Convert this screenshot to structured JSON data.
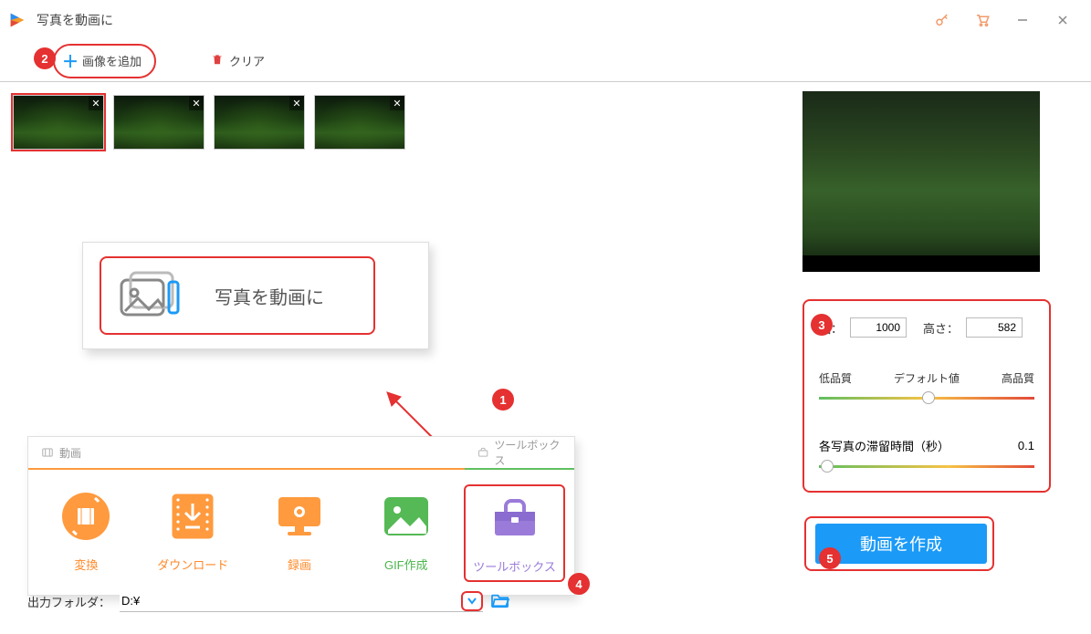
{
  "window": {
    "title": "写真を動画に"
  },
  "toolbar": {
    "add_image_label": "画像を追加",
    "clear_label": "クリア"
  },
  "thumbnails": [
    {
      "close": "✕"
    },
    {
      "close": "✕"
    },
    {
      "close": "✕"
    },
    {
      "close": "✕"
    }
  ],
  "popup": {
    "label": "写真を動画に"
  },
  "tools_tabs": {
    "video_tab": "動画",
    "toolbox_tab": "ツールボックス"
  },
  "tools": {
    "convert": "変換",
    "download": "ダウンロード",
    "record": "録画",
    "gif": "GIF作成",
    "toolbox": "ツールボックス"
  },
  "output": {
    "label": "出力フォルダ：",
    "value": "D:¥"
  },
  "settings": {
    "width_label": "幅：",
    "width_value": "1000",
    "height_label": "高さ：",
    "height_value": "582",
    "quality_low": "低品質",
    "quality_default": "デフォルト値",
    "quality_high": "高品質",
    "duration_label": "各写真の滞留時間（秒）",
    "duration_value": "0.1"
  },
  "create_button": "動画を作成",
  "badges": {
    "b1": "1",
    "b2": "2",
    "b3": "3",
    "b4": "4",
    "b5": "5"
  }
}
